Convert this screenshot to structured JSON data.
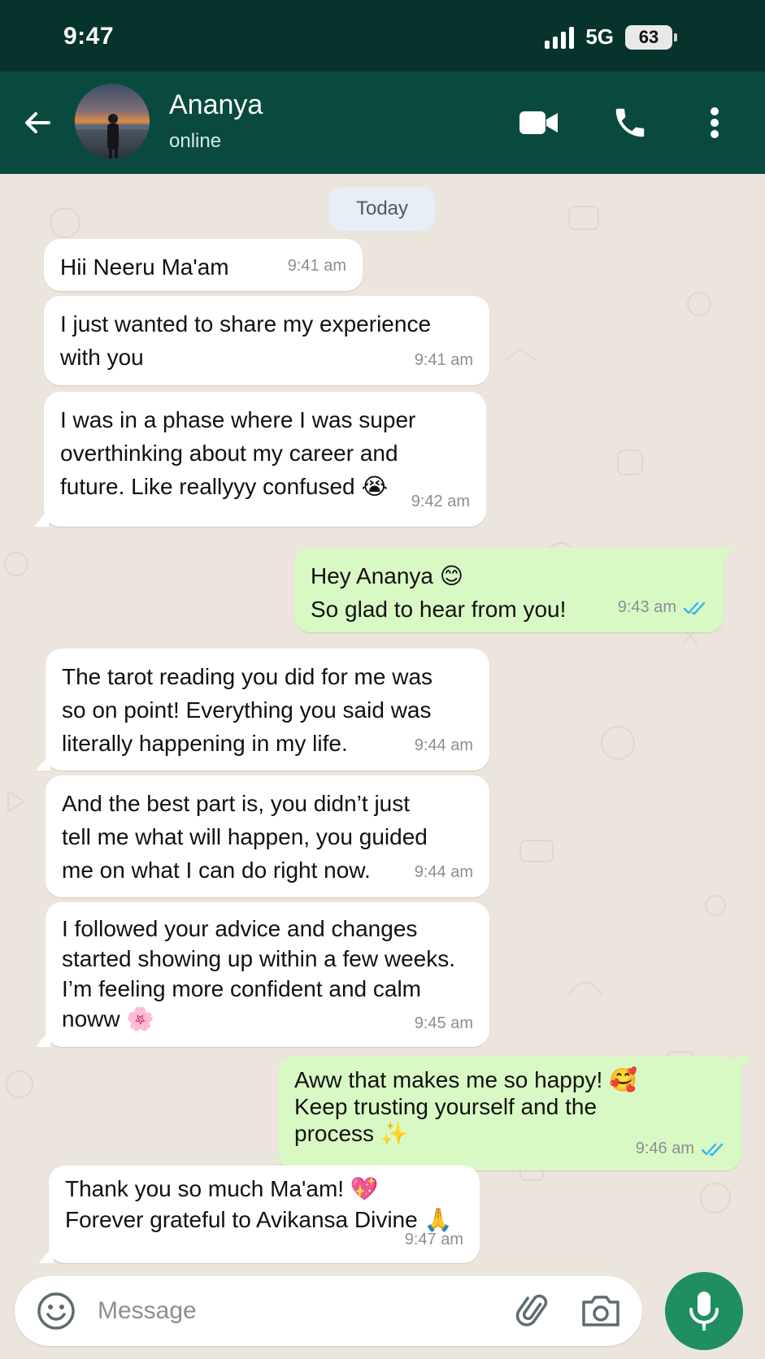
{
  "status_bar": {
    "time": "9:47",
    "network": "5G",
    "battery": "63"
  },
  "header": {
    "contact_name": "Ananya",
    "contact_status": "online"
  },
  "chat": {
    "date_label": "Today",
    "messages": [
      {
        "direction": "in",
        "text": "Hii Neeru Ma'am",
        "time": "9:41 am"
      },
      {
        "direction": "in",
        "text": "I just wanted to share my experience\nwith you",
        "time": "9:41 am"
      },
      {
        "direction": "in",
        "text": "I was in a phase where I was super\noverthinking about my career and\nfuture. Like reallyyy confused 😭",
        "time": "9:42 am"
      },
      {
        "direction": "out",
        "text": "Hey Ananya 😊\nSo glad to hear from you!",
        "time": "9:43 am"
      },
      {
        "direction": "in",
        "text": "The tarot reading you did for me was\nso on point! Everything you said was\nliterally happening in my life.",
        "time": "9:44 am"
      },
      {
        "direction": "in",
        "text": "And the best part is, you didn’t just\ntell me what will happen, you guided\nme on what I can do right now.",
        "time": "9:44 am"
      },
      {
        "direction": "in",
        "text": "I followed your advice and changes\nstarted showing up within a few weeks.\nI’m feeling more confident and calm\nnoww 🌸",
        "time": "9:45 am"
      },
      {
        "direction": "out",
        "text": "Aww that makes me so happy! 🥰\nKeep trusting yourself and the\nprocess ✨",
        "time": "9:46 am"
      },
      {
        "direction": "in",
        "text": "Thank you so much Ma'am! 💖\nForever grateful to Avikansa Divine 🙏",
        "time": "9:47 am"
      }
    ]
  },
  "composer": {
    "placeholder": "Message"
  },
  "colors": {
    "status_bar": "#06332b",
    "app_bar": "#0a4a3e",
    "chat_bg": "#ece5dd",
    "incoming_bubble": "#ffffff",
    "outgoing_bubble": "#d9f9c4",
    "read_ticks": "#34b7f1",
    "mic_button": "#1f8f62"
  },
  "icons": {
    "back": "arrow-left-icon",
    "video": "video-camera-icon",
    "call": "phone-icon",
    "menu": "three-dots-icon",
    "emoji": "emoji-icon",
    "attach": "paperclip-icon",
    "camera": "camera-icon",
    "mic": "microphone-icon"
  }
}
